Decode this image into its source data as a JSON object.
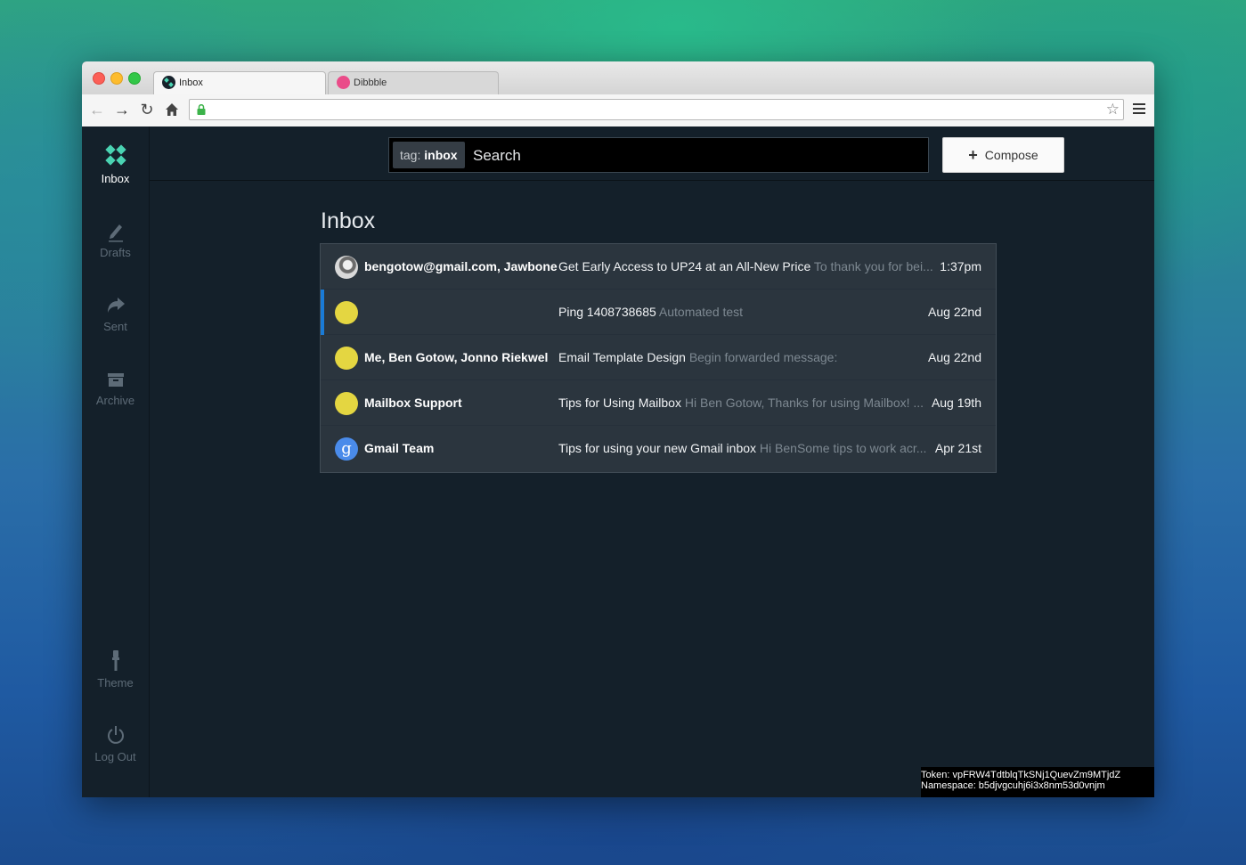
{
  "browser": {
    "tabs": [
      {
        "label": "Inbox",
        "icon": "inbox-app-favicon"
      },
      {
        "label": "Dibbble",
        "icon": "dribbble-favicon"
      }
    ],
    "address": ""
  },
  "sidebar": {
    "items": [
      {
        "label": "Inbox",
        "icon": "inbox-logo-icon",
        "active": true
      },
      {
        "label": "Drafts",
        "icon": "pencil-icon"
      },
      {
        "label": "Sent",
        "icon": "share-arrow-icon"
      },
      {
        "label": "Archive",
        "icon": "archive-box-icon"
      },
      {
        "label": "Theme",
        "icon": "brush-icon"
      },
      {
        "label": "Log Out",
        "icon": "power-icon"
      }
    ]
  },
  "search": {
    "tag_prefix": "tag:",
    "tag_value": "inbox",
    "placeholder": "Search"
  },
  "compose": {
    "label": "Compose"
  },
  "page_title": "Inbox",
  "threads": [
    {
      "participants": "bengotow@gmail.com, Jawbone",
      "subject": "Get Early Access to UP24 at an All-New Price",
      "snippet": "To thank you for bei...",
      "date": "1:37pm",
      "avatar": "photo"
    },
    {
      "participants": "",
      "subject": "Ping 1408738685",
      "snippet": "Automated test",
      "date": "Aug 22nd",
      "avatar": "yellow"
    },
    {
      "participants": "Me, Ben Gotow, Jonno Riekwel",
      "subject": "Email Template Design",
      "snippet": "Begin forwarded message:",
      "date": "Aug 22nd",
      "avatar": "yellow"
    },
    {
      "participants": "Mailbox Support",
      "subject": "Tips for Using Mailbox",
      "snippet": "Hi Ben Gotow, Thanks for using Mailbox! ...",
      "date": "Aug 19th",
      "avatar": "yellow"
    },
    {
      "participants": "Gmail Team",
      "subject": "Tips for using your new Gmail inbox",
      "snippet": "Hi BenSome tips to work acr...",
      "date": "Apr 21st",
      "avatar": "google"
    }
  ],
  "debug": {
    "token": "Token: vpFRW4TdtblqTkSNj1QuevZm9MTjdZ",
    "namespace": "Namespace: b5djvgcuhj6i3x8nm53d0vnjm"
  },
  "colors": {
    "app_bg": "#14202a",
    "accent_blue": "#1a7bd6",
    "logo_teal": "#4ad3b2",
    "avatar_yellow": "#e4d641"
  }
}
